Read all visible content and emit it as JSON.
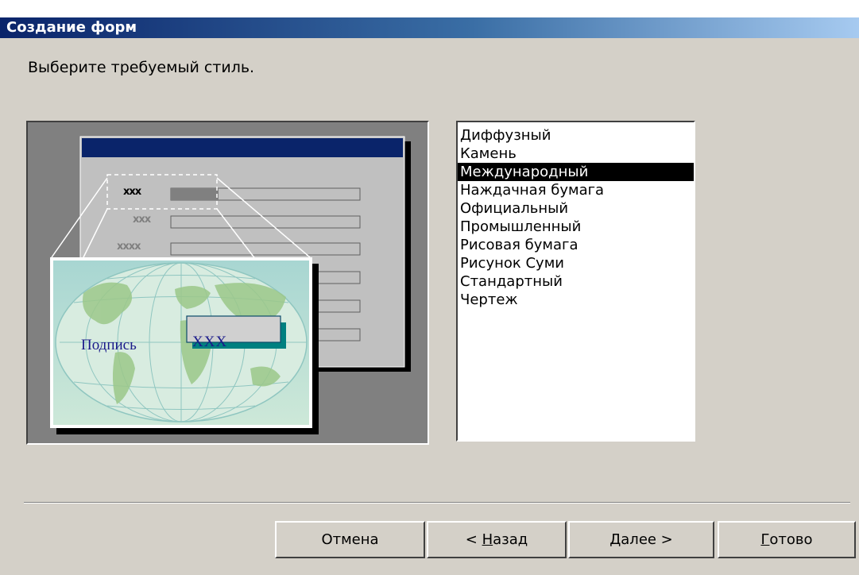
{
  "window": {
    "title": "Создание форм"
  },
  "prompt": "Выберите требуемый стиль.",
  "preview": {
    "mini_labels": [
      "xxx",
      "xxx",
      "xxxx"
    ],
    "caption": "Подпись",
    "field_text": "XXX"
  },
  "styles": {
    "items": [
      "Диффузный",
      "Камень",
      "Международный",
      "Наждачная бумага",
      "Официальный",
      "Промышленный",
      "Рисовая бумага",
      "Рисунок Суми",
      "Стандартный",
      "Чертеж"
    ],
    "selected": "Международный"
  },
  "buttons": {
    "cancel": "Отмена",
    "back_prefix": "< ",
    "back_accel": "Н",
    "back_rest": "азад",
    "next_accel": "Д",
    "next_rest": "алее >",
    "finish_accel": "Г",
    "finish_rest": "отово"
  },
  "colors": {
    "dialog_bg": "#d4d0c8",
    "title_start": "#0a246a",
    "title_end": "#a6caf0",
    "selection_bg": "#000000",
    "caption_text": "#1a1a8a"
  }
}
